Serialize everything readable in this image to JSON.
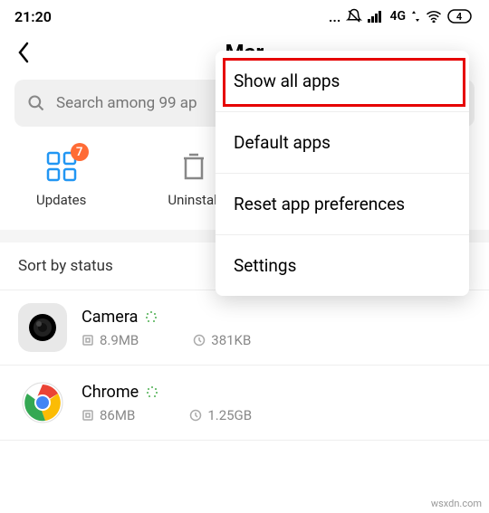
{
  "status": {
    "time": "21:20",
    "network": "4G",
    "battery": "4"
  },
  "header": {
    "title": "Mar"
  },
  "search": {
    "placeholder": "Search among 99 ap"
  },
  "actions": {
    "updates": {
      "label": "Updates",
      "badge": "7"
    },
    "uninstall": {
      "label": "Uninstall"
    }
  },
  "sort": {
    "label": "Sort by status"
  },
  "apps": [
    {
      "name": "Camera",
      "apk_size": "8.9MB",
      "storage": "381KB"
    },
    {
      "name": "Chrome",
      "apk_size": "86MB",
      "storage": "1.25GB"
    }
  ],
  "menu": {
    "items": [
      "Show all apps",
      "Default apps",
      "Reset app preferences",
      "Settings"
    ]
  },
  "watermark": "wsxdn.com"
}
